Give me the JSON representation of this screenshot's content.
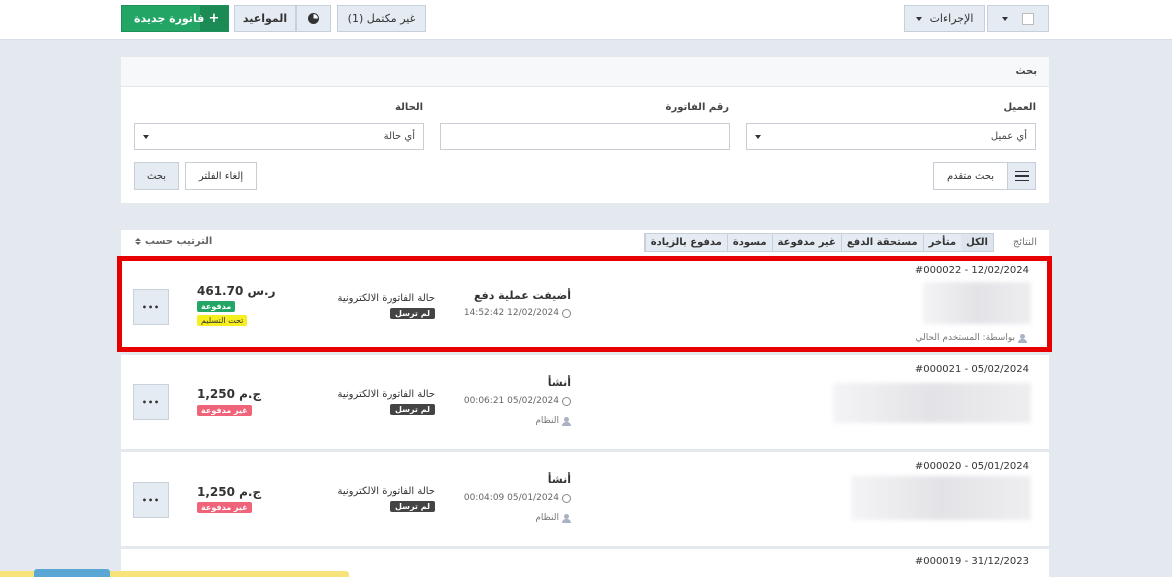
{
  "toolbar": {
    "new_invoice_label": "فاتورة جديدة",
    "plus_glyph": "+",
    "appointments_label": "المواعيد",
    "incomplete_label": "غير مكتمل (1)",
    "actions_label": "الإجراءات"
  },
  "search": {
    "title": "بحث",
    "client_label": "العميل",
    "client_value": "أي عميل",
    "invoice_number_label": "رقم الفاتورة",
    "status_label": "الحالة",
    "status_value": "أي حالة",
    "advanced_label": "بحث متقدم",
    "cancel_filter_label": "إلغاء الفلتر",
    "search_button_label": "بحث"
  },
  "results": {
    "label": "النتائج",
    "tabs": [
      "الكل",
      "متأخر",
      "مستحقة الدفع",
      "غير مدفوعة",
      "مسودة",
      "مدفوع بالزيادة"
    ],
    "sort_label": "الترتيب حسب"
  },
  "invoices": [
    {
      "number_date": "#000022 - 12/02/2024",
      "action": "أضيفت عملية دفع",
      "timestamp": "14:52:42 12/02/2024",
      "user": "بواسطة: المستخدم الحالي",
      "einvoice_label": "حالة الفاتورة الالكترونية",
      "einvoice_status": "لم ترسل",
      "amount": "461.70 ر.س",
      "status": "مدفوعة",
      "delivery": "تحت التسليم",
      "more_glyph": "•••"
    },
    {
      "number_date": "#000021 - 05/02/2024",
      "action": "أنشأ",
      "timestamp": "00:06:21 05/02/2024",
      "user": "النظام",
      "einvoice_label": "حالة الفاتورة الالكترونية",
      "einvoice_status": "لم ترسل",
      "amount": "1,250 ج.م",
      "status": "غير مدفوعة",
      "more_glyph": "•••"
    },
    {
      "number_date": "#000020 - 05/01/2024",
      "action": "أنشأ",
      "timestamp": "00:04:09 05/01/2024",
      "user": "النظام",
      "einvoice_label": "حالة الفاتورة الالكترونية",
      "einvoice_status": "لم ترسل",
      "amount": "1,250 ج.م",
      "status": "غير مدفوعة",
      "more_glyph": "•••"
    },
    {
      "number_date": "#000019 - 31/12/2023"
    }
  ],
  "colors": {
    "green": "#22a565",
    "unpaid": "#f0647a",
    "delivery": "#f6ee1f",
    "highlight": "#e60000"
  }
}
